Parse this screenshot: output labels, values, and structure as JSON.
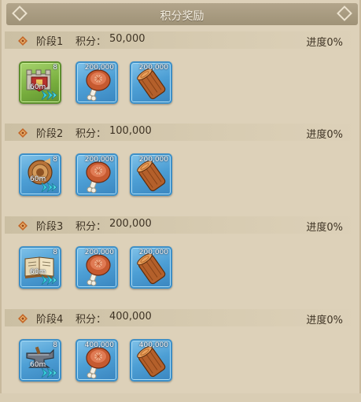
{
  "title": "积分奖励",
  "score_label": "积分：",
  "progress_label": "进度0%",
  "stages": [
    {
      "name": "阶段1",
      "score": "50,000",
      "items": [
        {
          "type": "speedup",
          "icon": "wall-speedup-icon",
          "count": "8",
          "duration": "60m",
          "frame": "green"
        },
        {
          "type": "meat",
          "icon": "meat-icon",
          "count": "200,000",
          "frame": "blue"
        },
        {
          "type": "wood",
          "icon": "wood-icon",
          "count": "200,000",
          "frame": "blue"
        }
      ]
    },
    {
      "name": "阶段2",
      "score": "100,000",
      "items": [
        {
          "type": "speedup",
          "icon": "horn-speedup-icon",
          "count": "8",
          "duration": "60m",
          "frame": "blue"
        },
        {
          "type": "meat",
          "icon": "meat-icon",
          "count": "200,000",
          "frame": "blue"
        },
        {
          "type": "wood",
          "icon": "wood-icon",
          "count": "200,000",
          "frame": "blue"
        }
      ]
    },
    {
      "name": "阶段3",
      "score": "200,000",
      "items": [
        {
          "type": "speedup",
          "icon": "book-speedup-icon",
          "count": "8",
          "duration": "60m",
          "frame": "blue"
        },
        {
          "type": "meat",
          "icon": "meat-icon",
          "count": "200,000",
          "frame": "blue"
        },
        {
          "type": "wood",
          "icon": "wood-icon",
          "count": "200,000",
          "frame": "blue"
        }
      ]
    },
    {
      "name": "阶段4",
      "score": "400,000",
      "items": [
        {
          "type": "speedup",
          "icon": "anvil-speedup-icon",
          "count": "8",
          "duration": "60m",
          "frame": "blue"
        },
        {
          "type": "meat",
          "icon": "meat-icon",
          "count": "400,000",
          "frame": "blue"
        },
        {
          "type": "wood",
          "icon": "wood-icon",
          "count": "400,000",
          "frame": "blue"
        }
      ]
    }
  ],
  "colors": {
    "background": "#ddd1b9",
    "title_bar": "#a89b80",
    "text": "#3e3324",
    "item_blue": "#4d9fd5",
    "item_green": "#77ad3d",
    "arrow_cyan": "#39d3e0"
  }
}
